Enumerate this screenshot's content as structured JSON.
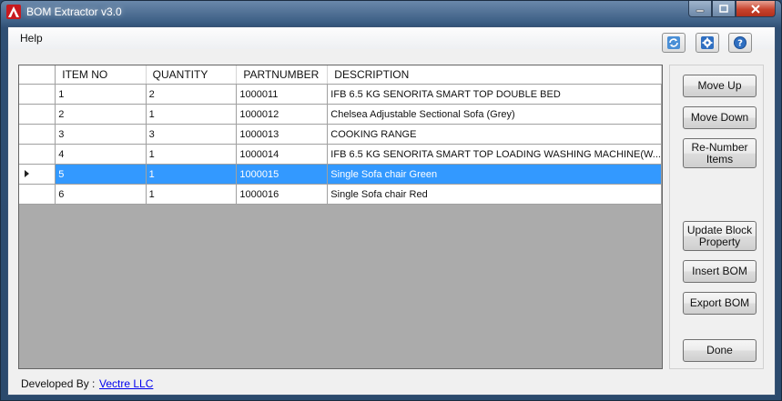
{
  "window": {
    "title": "BOM Extractor v3.0"
  },
  "menu": {
    "help": "Help"
  },
  "toolbar": {
    "refresh_icon": "refresh-icon",
    "settings_icon": "gear-icon",
    "help_icon": "help-icon"
  },
  "grid": {
    "columns": [
      "ITEM NO",
      "QUANTITY",
      "PARTNUMBER",
      "DESCRIPTION"
    ],
    "rows": [
      [
        "1",
        "2",
        "1000011",
        "IFB 6.5 KG SENORITA SMART TOP DOUBLE BED"
      ],
      [
        "2",
        "1",
        "1000012",
        "Chelsea Adjustable Sectional Sofa (Grey)"
      ],
      [
        "3",
        "3",
        "1000013",
        "COOKING RANGE"
      ],
      [
        "4",
        "1",
        "1000014",
        "IFB 6.5 KG SENORITA SMART TOP LOADING WASHING MACHINE(W..."
      ],
      [
        "5",
        "1",
        "1000015",
        "Single Sofa chair Green"
      ],
      [
        "6",
        "1",
        "1000016",
        "Single Sofa chair Red"
      ]
    ],
    "selected_row": 4
  },
  "buttons": {
    "move_up": "Move Up",
    "move_down": "Move Down",
    "renumber": "Re-Number Items",
    "update_block": "Update Block Property",
    "insert_bom": "Insert BOM",
    "export_bom": "Export BOM",
    "done": "Done"
  },
  "footer": {
    "developed_by": "Developed By :",
    "company": "Vectre LLC"
  },
  "colors": {
    "selection": "#3399ff",
    "grid_background": "#ababab",
    "link": "#0000ee"
  }
}
